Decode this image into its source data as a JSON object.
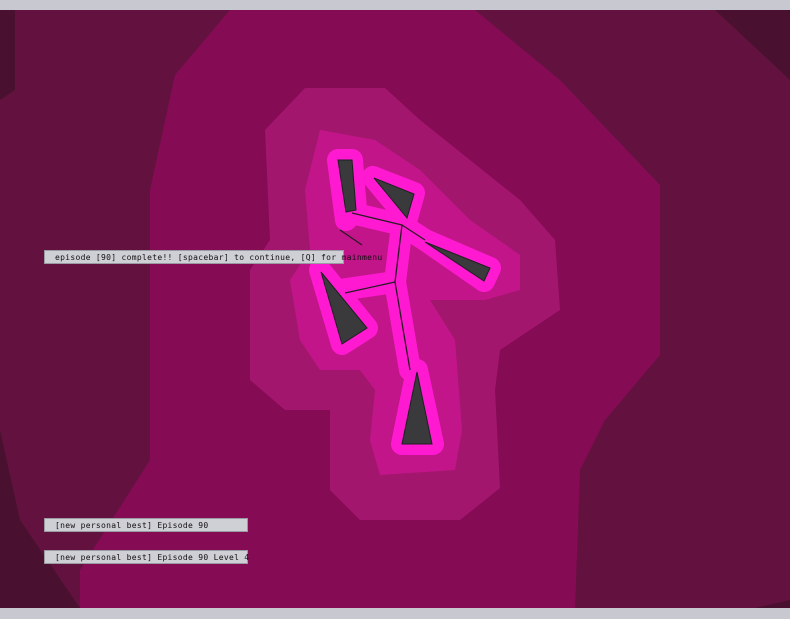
{
  "messages": {
    "episode_complete": "episode [90] complete!!  [spacebar] to continue, [Q] for mainmenu",
    "personal_best_episode": "[new personal best]  Episode 90",
    "personal_best_level": "[new personal best]  Episode 90 Level 4"
  },
  "colors": {
    "frame": "#c8c8d0",
    "background_outer": "#4a1030",
    "background_dark": "#63123f",
    "background_mid": "#850b55",
    "glow_1": "#a3166e",
    "glow_2": "#c21589",
    "glow_core": "#ff1ad1",
    "shard": "#3a3a3d",
    "message_bg": "#cfcfd6"
  }
}
